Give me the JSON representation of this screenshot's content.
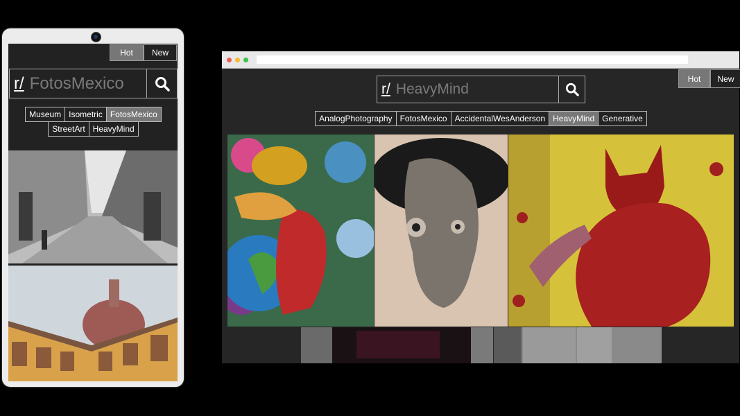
{
  "mobile": {
    "sort": {
      "hot_label": "Hot",
      "new_label": "New",
      "active": "Hot"
    },
    "search": {
      "prefix": "r/",
      "value": "FotosMexico",
      "icon": "search-icon"
    },
    "subreddits": [
      {
        "label": "Museum",
        "active": false
      },
      {
        "label": "Isometric",
        "active": false
      },
      {
        "label": "FotosMexico",
        "active": true
      },
      {
        "label": "StreetArt",
        "active": false
      },
      {
        "label": "HeavyMind",
        "active": false
      }
    ],
    "photos": [
      {
        "desc": "black-and-white colonial street"
      },
      {
        "desc": "cathedral dome and yellow arcade courtyard"
      }
    ]
  },
  "desktop": {
    "window_controls": {
      "close_color": "#ec5f57",
      "minimize_color": "#f3bd2f",
      "maximize_color": "#3ec24a"
    },
    "sort": {
      "hot_label": "Hot",
      "new_label": "New",
      "active": "Hot"
    },
    "search": {
      "prefix": "r/",
      "value": "HeavyMind",
      "icon": "search-icon"
    },
    "subreddits": [
      {
        "label": "AnalogPhotography",
        "active": false
      },
      {
        "label": "FotosMexico",
        "active": false
      },
      {
        "label": "AccidentalWesAnderson",
        "active": false
      },
      {
        "label": "HeavyMind",
        "active": true
      },
      {
        "label": "Generative",
        "active": false
      }
    ],
    "gallery": [
      {
        "desc": "psychedelic earth-head painting"
      },
      {
        "desc": "surreal ink face drawing"
      },
      {
        "desc": "red devil figure painting"
      },
      {
        "desc": "dark textured painting"
      },
      {
        "desc": "grey minimal image"
      }
    ]
  }
}
